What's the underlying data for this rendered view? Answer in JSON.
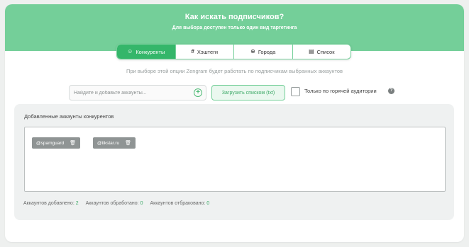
{
  "header": {
    "title": "Как искать подписчиков?",
    "subtitle": "Для выбора доступен только один вид таргетинга"
  },
  "tabs": [
    {
      "label": "Конкуренты",
      "icon": "☺",
      "icon_name": "competitors-icon",
      "active": true
    },
    {
      "label": "Хэштеги",
      "icon": "#",
      "icon_name": "hashtag-icon",
      "active": false
    },
    {
      "label": "Города",
      "icon": "⊕",
      "icon_name": "globe-icon",
      "active": false
    },
    {
      "label": "Список",
      "icon": "▤",
      "icon_name": "list-icon",
      "active": false
    }
  ],
  "hint": "При выборе этой опции Zengram будет работать по подписчикам выбранных аккаунтов",
  "search": {
    "placeholder": "Найдите и добавьте аккаунты...",
    "add_icon": "+"
  },
  "upload_button": "Загрузить списком (txt)",
  "hot_audience": {
    "label": "Только по горячей аудитории",
    "help_icon": "?",
    "checked": false
  },
  "panel": {
    "title": "Добавленные аккаунты конкурентов",
    "accounts": [
      {
        "name": "@spamguard",
        "trash_icon": "🗑"
      },
      {
        "name": "@tikstar.ru",
        "trash_icon": "🗑"
      }
    ]
  },
  "stats": {
    "added_label": "Аккаунтов добавлено:",
    "added_value": "2",
    "processed_label": "Аккаунтов обработано:",
    "processed_value": "0",
    "rejected_label": "Аккаунтов отбраковано:",
    "rejected_value": "0"
  },
  "colors": {
    "header_green": "#74cf99",
    "active_tab": "#34b66a",
    "accent_text": "#3aa865"
  }
}
